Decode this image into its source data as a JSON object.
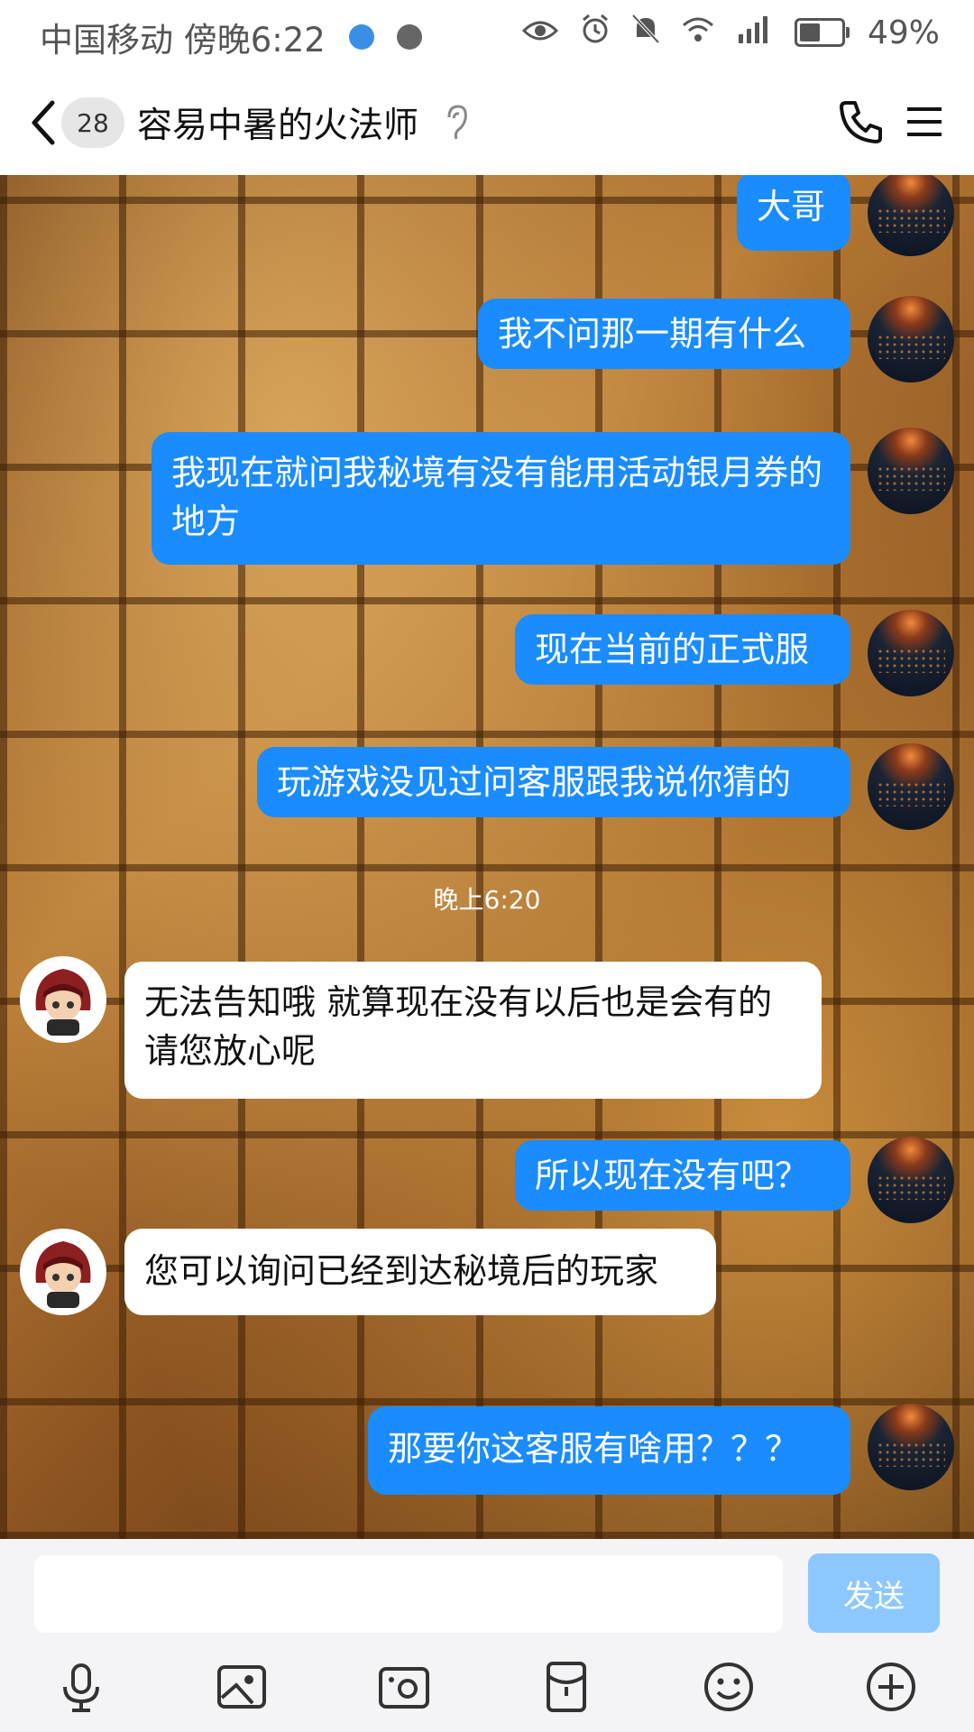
{
  "status": {
    "carrier": "中国移动",
    "time": "傍晚6:22",
    "battery": "49%",
    "battery_level": 0.49,
    "network": "4G"
  },
  "header": {
    "unread_count": "28",
    "title": "容易中暑的火法师"
  },
  "messages": [
    {
      "side": "out",
      "text": "大哥"
    },
    {
      "side": "out",
      "text": "我不问那一期有什么"
    },
    {
      "side": "out",
      "text": "我现在就问我秘境有没有能用活动银月券的地方"
    },
    {
      "side": "out",
      "text": "现在当前的正式服"
    },
    {
      "side": "out",
      "text": "玩游戏没见过问客服跟我说你猜的"
    },
    {
      "side": "in",
      "text": " 无法告知哦 就算现在没有以后也是会有的 请您放心呢"
    },
    {
      "side": "out",
      "text": "所以现在没有吧？"
    },
    {
      "side": "in",
      "text": "您可以询问已经到达秘境后的玩家"
    },
    {
      "side": "out",
      "text": "那要你这客服有啥用？？？"
    }
  ],
  "timestamp": "晚上6:20",
  "input": {
    "value": "",
    "send_label": "发送"
  },
  "colors": {
    "outgoing_bubble": "#1a8cff",
    "incoming_bubble": "#ffffff",
    "send_disabled": "#8cc8ff"
  },
  "icons": {
    "toolbar": [
      "microphone-icon",
      "image-icon",
      "camera-icon",
      "red-packet-icon",
      "emoji-icon",
      "plus-icon"
    ]
  }
}
